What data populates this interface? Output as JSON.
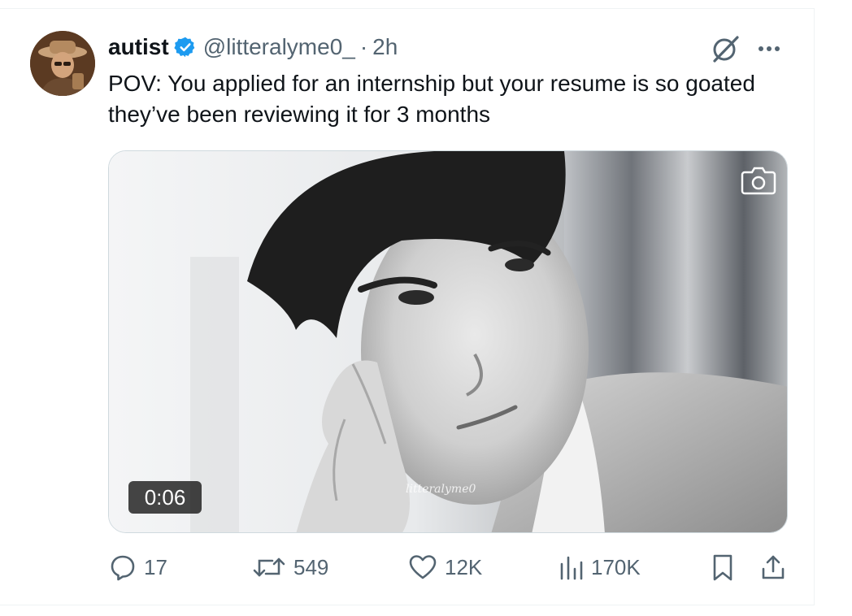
{
  "tweet": {
    "display_name": "autist",
    "handle": "@litteralyme0_",
    "separator": "·",
    "time": "2h",
    "text": "POV: You applied for an internship but your resume is so goated they’ve been reviewing it for 3 months"
  },
  "media": {
    "type": "video",
    "duration": "0:06",
    "watermark": "litteralyme0"
  },
  "actions": {
    "replies": "17",
    "reposts": "549",
    "likes": "12K",
    "views": "170K"
  },
  "colors": {
    "text_primary": "#0f1419",
    "text_secondary": "#536471",
    "verified_blue": "#1d9bf0",
    "border": "#eff3f4"
  },
  "icons": {
    "verified": "verified-badge-icon",
    "grok": "grok-icon",
    "more": "more-icon",
    "camera": "camera-icon",
    "reply": "reply-icon",
    "repost": "repost-icon",
    "like": "heart-icon",
    "views": "views-icon",
    "bookmark": "bookmark-icon",
    "share": "share-icon"
  }
}
